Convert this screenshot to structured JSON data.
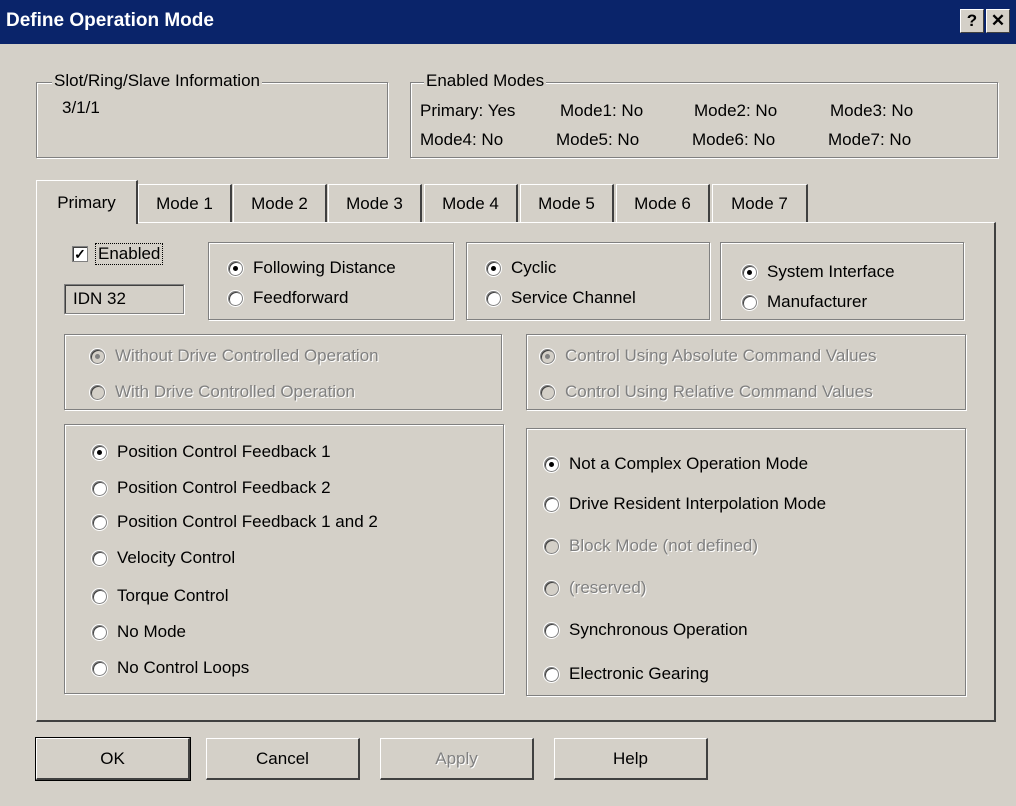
{
  "window": {
    "title": "Define Operation Mode",
    "help_glyph": "?",
    "close_glyph": "✕"
  },
  "slot_info": {
    "label": "Slot/Ring/Slave Information",
    "value": "3/1/1"
  },
  "enabled_modes": {
    "label": "Enabled Modes",
    "rows": [
      [
        "Primary: Yes",
        "Mode1: No",
        "Mode2: No",
        "Mode3: No"
      ],
      [
        "Mode4: No",
        "Mode5: No",
        "Mode6: No",
        "Mode7: No"
      ]
    ]
  },
  "tabs": [
    "Primary",
    "Mode 1",
    "Mode 2",
    "Mode 3",
    "Mode 4",
    "Mode 5",
    "Mode 6",
    "Mode 7"
  ],
  "active_tab": "Primary",
  "primary": {
    "enabled_label": "Enabled",
    "enabled_checked": true,
    "idn_value": "IDN 32",
    "distance_group": {
      "options": [
        "Following Distance",
        "Feedforward"
      ],
      "selected": "Following Distance"
    },
    "channel_group": {
      "options": [
        "Cyclic",
        "Service Channel"
      ],
      "selected": "Cyclic"
    },
    "interface_group": {
      "options": [
        "System Interface",
        "Manufacturer"
      ],
      "selected": "System Interface"
    },
    "drive_op_group": {
      "options": [
        "Without Drive Controlled Operation",
        "With Drive Controlled Operation"
      ],
      "selected": "Without Drive Controlled Operation",
      "disabled": true
    },
    "command_group": {
      "options": [
        "Control Using Absolute Command Values",
        "Control Using Relative Command Values"
      ],
      "selected": "Control Using Absolute Command Values",
      "disabled": true
    },
    "control_group": {
      "options": [
        "Position Control Feedback 1",
        "Position Control Feedback 2",
        "Position Control Feedback 1 and 2",
        "Velocity Control",
        "Torque Control",
        "No Mode",
        "No Control Loops"
      ],
      "selected": "Position Control Feedback 1"
    },
    "complex_group": {
      "options": [
        "Not a Complex Operation Mode",
        "Drive Resident Interpolation Mode",
        "Block Mode (not defined)",
        "(reserved)",
        "Synchronous Operation",
        "Electronic Gearing"
      ],
      "selected": "Not a Complex Operation Mode",
      "disabled_options": [
        "Block Mode (not defined)",
        "(reserved)"
      ]
    }
  },
  "buttons": {
    "ok": "OK",
    "cancel": "Cancel",
    "apply": "Apply",
    "help": "Help"
  },
  "colors": {
    "titlebar": "#0a246a",
    "face": "#d4d0c8",
    "disabled_text": "#808080"
  }
}
